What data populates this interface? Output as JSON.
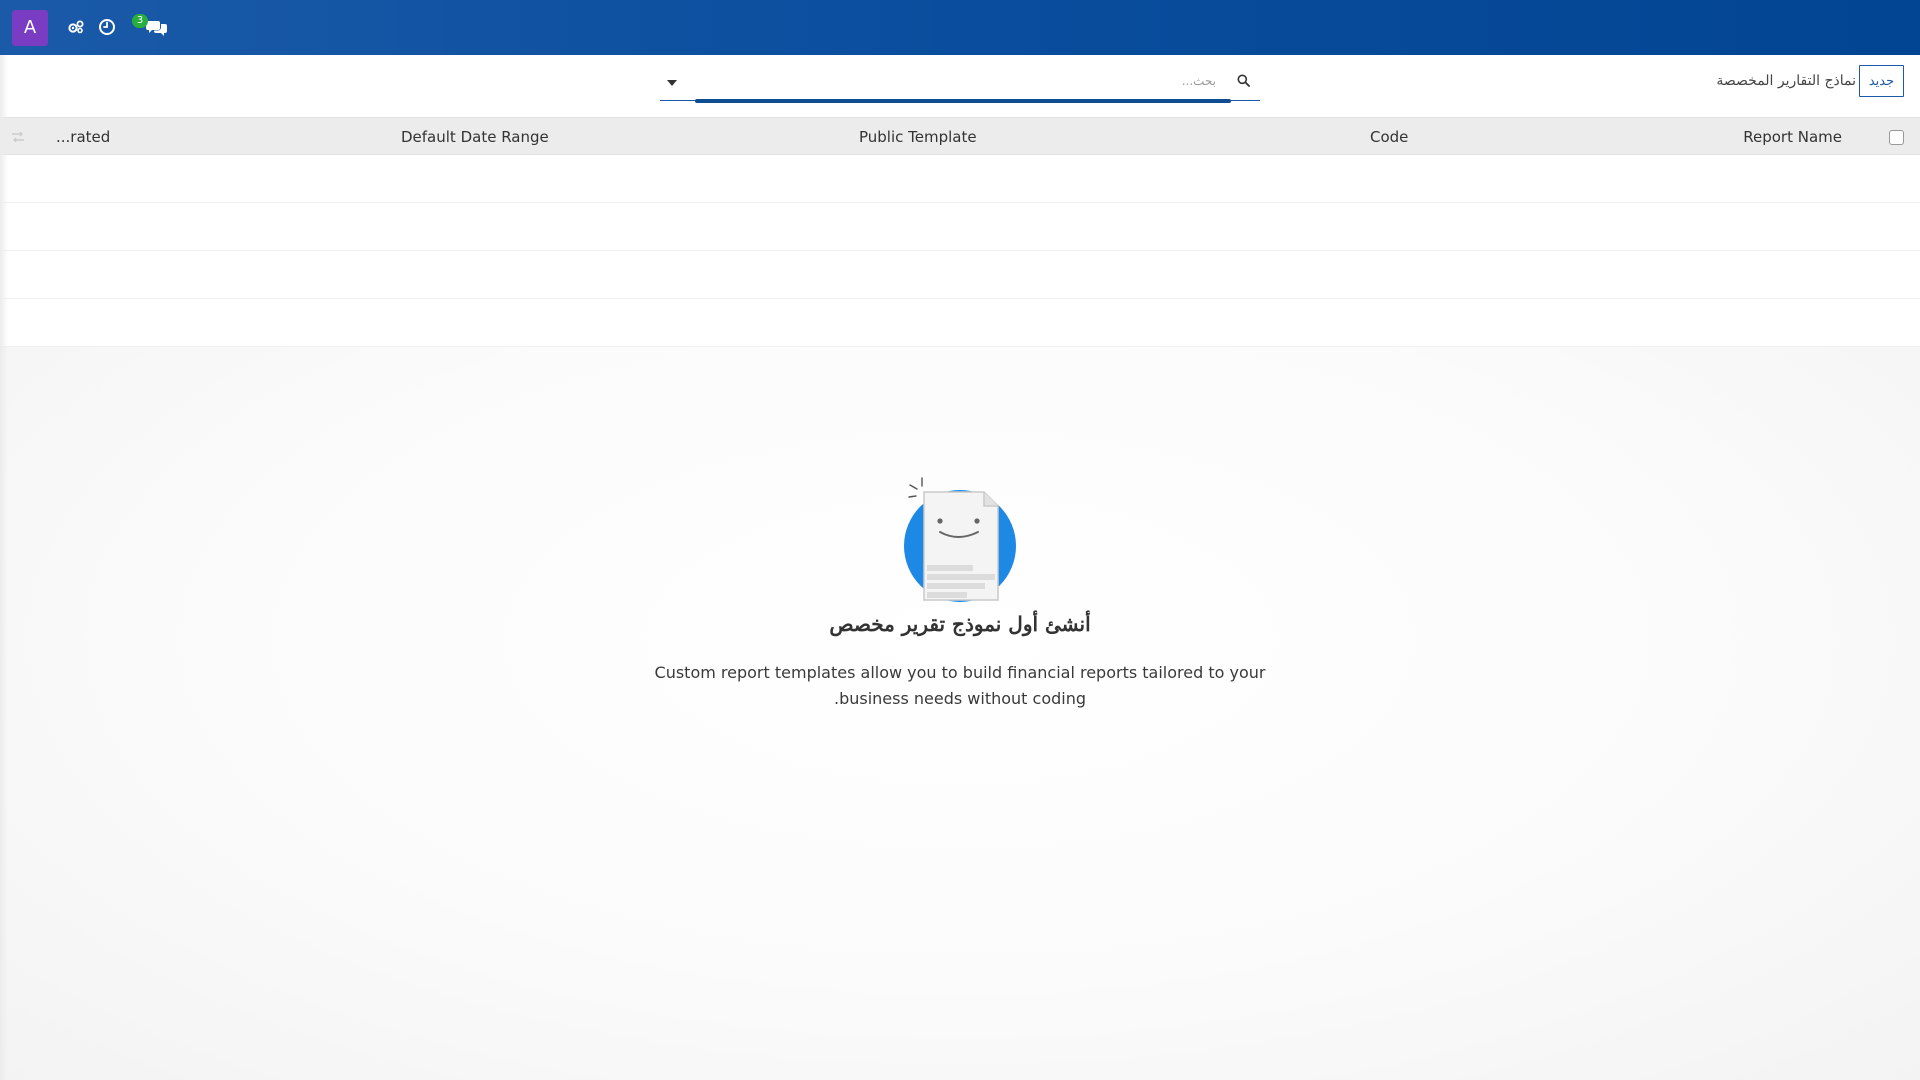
{
  "app": {
    "user_initial": "A",
    "notification_count": "3"
  },
  "topbar": {
    "icons": [
      "settings-gears-icon",
      "history-clock-icon",
      "chat-icon"
    ],
    "color_start": "#1a5aa8",
    "color_end": "#024592"
  },
  "control_panel": {
    "new_button_label": "جديد",
    "title": "نماذج التقارير المخصصة",
    "search": {
      "placeholder": "بحث...",
      "value": ""
    }
  },
  "table": {
    "columns": {
      "report_name": "Report Name",
      "code": "Code",
      "public_template": "Public Template",
      "default_date_range": "Default Date Range",
      "rated": "...rated"
    },
    "rows": []
  },
  "empty_state": {
    "title": "أنشئ أول نموذج تقرير مخصص",
    "description_line1": "Custom report templates allow you to build financial reports tailored to your",
    "description_line2": ".business needs without coding"
  },
  "colors": {
    "accent": "#1a5aa8",
    "avatar": "#7a3cc2",
    "badge": "#27ae3e",
    "header_bg": "#ececec"
  }
}
